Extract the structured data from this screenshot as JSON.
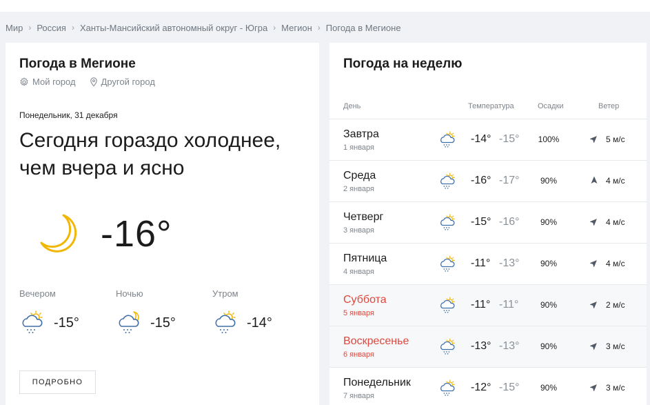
{
  "breadcrumbs": [
    "Мир",
    "Россия",
    "Ханты-Мансийский автономный округ - Югра",
    "Мегион",
    "Погода в Мегионе"
  ],
  "breadcrumb_separator": "›",
  "today": {
    "title": "Погода в Мегионе",
    "my_city": "Мой город",
    "other_city": "Другой город",
    "date": "Понедельник, 31 декабря",
    "headline": "Сегодня гораздо холоднее, чем вчера и ясно",
    "icon": "moon-icon",
    "temp": "-16°",
    "parts": [
      {
        "label": "Вечером",
        "icon": "cloud-sun-snow-icon",
        "temp": "-15°"
      },
      {
        "label": "Ночью",
        "icon": "cloud-moon-snow-icon",
        "temp": "-15°"
      },
      {
        "label": "Утром",
        "icon": "cloud-sun-snow-icon",
        "temp": "-14°"
      }
    ],
    "more_button": "ПОДРОБНО"
  },
  "week": {
    "title": "Погода на неделю",
    "headers": {
      "day": "День",
      "temp": "Температура",
      "precip": "Осадки",
      "wind": "Ветер"
    },
    "accent_color": "#e0473d",
    "rows": [
      {
        "day": "Завтра",
        "date": "1 января",
        "weekend": false,
        "icon": "cloud-sun-snow-icon",
        "t_day": "-14°",
        "t_night": "-15°",
        "precip": "100%",
        "wind_dir": "north-east",
        "wind": "5 м/с"
      },
      {
        "day": "Среда",
        "date": "2 января",
        "weekend": false,
        "icon": "cloud-sun-snow-icon",
        "t_day": "-16°",
        "t_night": "-17°",
        "precip": "90%",
        "wind_dir": "north",
        "wind": "4 м/с"
      },
      {
        "day": "Четверг",
        "date": "3 января",
        "weekend": false,
        "icon": "cloud-sun-snow-icon",
        "t_day": "-15°",
        "t_night": "-16°",
        "precip": "90%",
        "wind_dir": "north-east",
        "wind": "4 м/с"
      },
      {
        "day": "Пятница",
        "date": "4 января",
        "weekend": false,
        "icon": "cloud-sun-snow-icon",
        "t_day": "-11°",
        "t_night": "-13°",
        "precip": "90%",
        "wind_dir": "north-east",
        "wind": "4 м/с"
      },
      {
        "day": "Суббота",
        "date": "5 января",
        "weekend": true,
        "icon": "cloud-sun-snow-icon",
        "t_day": "-11°",
        "t_night": "-11°",
        "precip": "90%",
        "wind_dir": "north-east",
        "wind": "2 м/с"
      },
      {
        "day": "Воскресенье",
        "date": "6 января",
        "weekend": true,
        "icon": "cloud-sun-snow-icon",
        "t_day": "-13°",
        "t_night": "-13°",
        "precip": "90%",
        "wind_dir": "north-east",
        "wind": "3 м/с"
      },
      {
        "day": "Понедельник",
        "date": "7 января",
        "weekend": false,
        "icon": "cloud-sun-snow-icon",
        "t_day": "-12°",
        "t_night": "-15°",
        "precip": "90%",
        "wind_dir": "north-east",
        "wind": "3 м/с"
      }
    ]
  }
}
